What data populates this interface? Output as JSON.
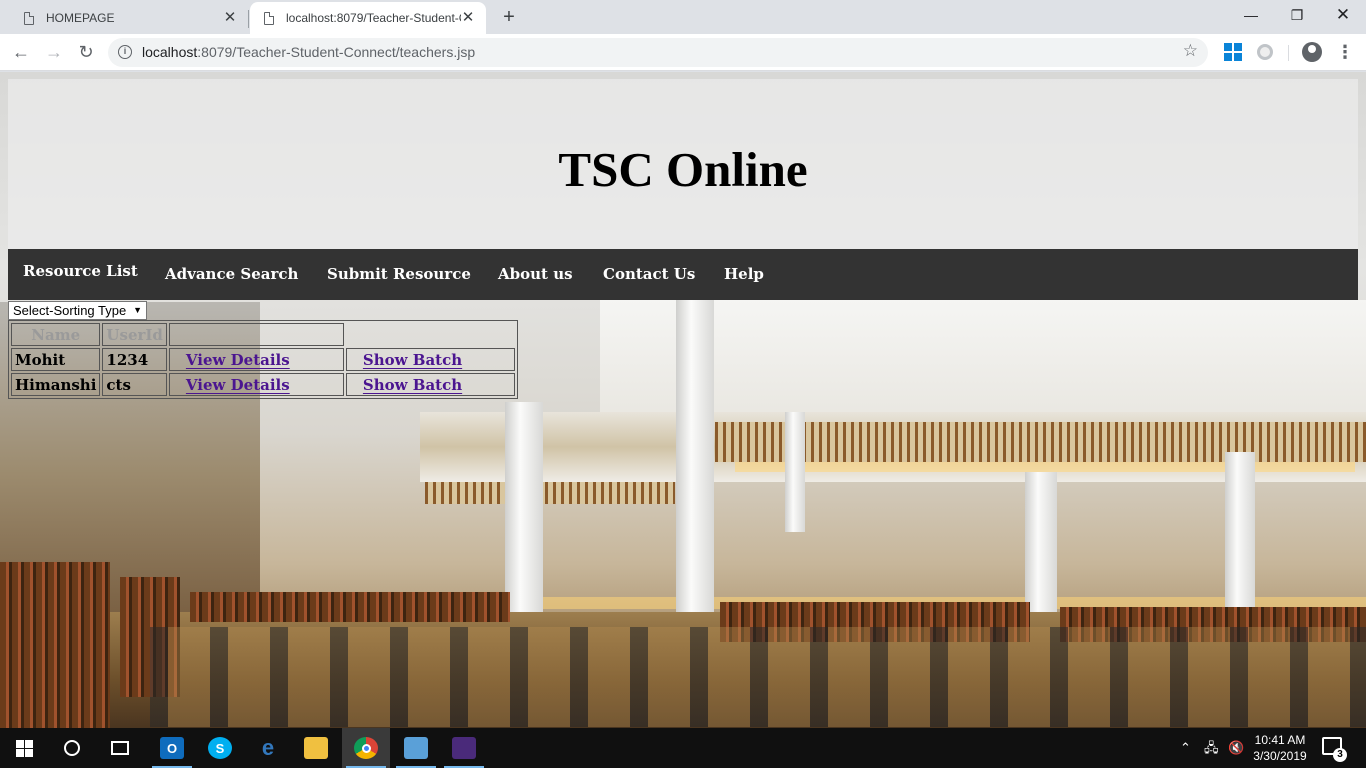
{
  "browser": {
    "tabs": [
      {
        "title": "HOMEPAGE",
        "active": false
      },
      {
        "title": "localhost:8079/Teacher-Student-C",
        "active": true
      }
    ],
    "url_host": "localhost",
    "url_rest": ":8079/Teacher-Student-Connect/teachers.jsp"
  },
  "header": {
    "title": "TSC Online"
  },
  "nav": {
    "items": [
      {
        "label": "Resource List"
      },
      {
        "label": "Advance Search"
      },
      {
        "label": "Submit Resource"
      },
      {
        "label": "About us"
      },
      {
        "label": "Contact Us"
      },
      {
        "label": "Help"
      }
    ]
  },
  "sort": {
    "selected": "Select-Sorting Type"
  },
  "table": {
    "columns": [
      "Name",
      "UserId",
      "",
      ""
    ],
    "rows": [
      {
        "name": "Mohit",
        "userid": "1234",
        "details_link": "View Details",
        "batch_link": "Show Batch"
      },
      {
        "name": "Himanshi",
        "userid": "cts",
        "details_link": "View Details",
        "batch_link": "Show Batch"
      }
    ]
  },
  "taskbar": {
    "time": "10:41 AM",
    "date": "3/30/2019",
    "notification_count": "3"
  },
  "colors": {
    "nav_bg": "#333333",
    "link": "#4b1590"
  }
}
